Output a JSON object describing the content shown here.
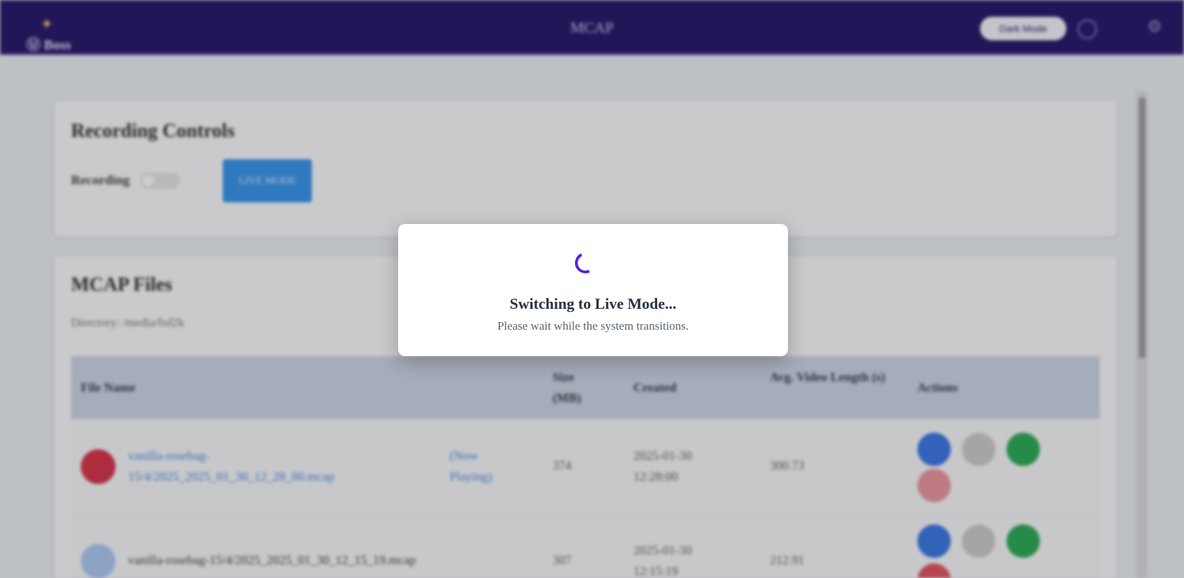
{
  "header": {
    "logo_text": "Ⓤ Boss",
    "app_title": "MCAP",
    "theme_button": "Dark Mode"
  },
  "recording_controls": {
    "title": "Recording Controls",
    "recording_label": "Recording",
    "recording_on": false,
    "live_mode_button": "LIVE MODE"
  },
  "files": {
    "title": "MCAP Files",
    "directory": "Directory: /media/fsd2k",
    "columns": [
      "File Name",
      "Size (MB)",
      "Created",
      "Avg. Video Length (s)",
      "Actions"
    ],
    "rows": [
      {
        "name": "vanilla-rosebag-15/4/2025_2025_01_30_12_28_00.mcap",
        "status": "(Now Playing)",
        "size": "374",
        "created": "2025-01-30 12:28:00",
        "avg_length": "300.73"
      },
      {
        "name": "vanilla-rosebag-15/4/2025_2025_01_30_12_15_19.mcap",
        "status": "",
        "size": "307",
        "created": "2025-01-30 12:15:19",
        "avg_length": "212.91"
      }
    ]
  },
  "modal": {
    "title": "Switching to Live Mode...",
    "subtitle": "Please wait while the system transitions."
  },
  "colors": {
    "header_bg": "#1a0a5e",
    "spinner": "#5b21d6",
    "live_button": "#2b8fe6"
  }
}
